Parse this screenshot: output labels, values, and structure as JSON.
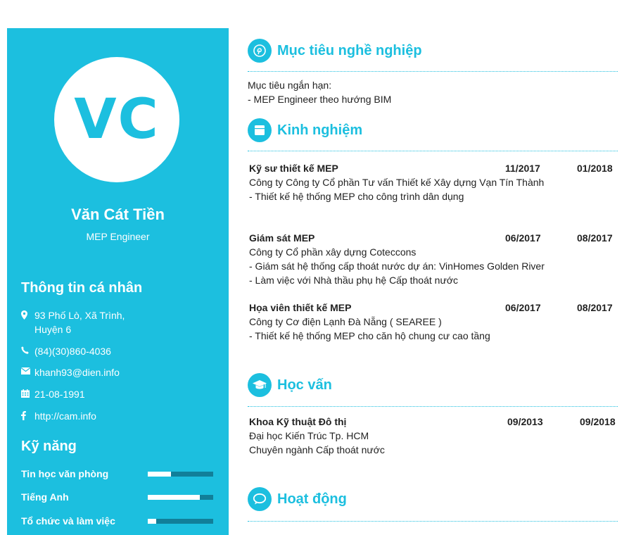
{
  "profile": {
    "initials": "VC",
    "name": "Văn Cát Tiền",
    "title": "MEP Engineer"
  },
  "personal": {
    "heading": "Thông tin cá nhân",
    "address_line1": "93 Phố Lò, Xã Trình,",
    "address_line2": "Huyện 6",
    "phone": "(84)(30)860-4036",
    "email": "khanh93@dien.info",
    "birthday": "21-08-1991",
    "website": "http://cam.info"
  },
  "skills": {
    "heading": "Kỹ năng",
    "items": [
      {
        "label": "Tin học văn phòng",
        "level": 0.35
      },
      {
        "label": "Tiếng Anh",
        "level": 0.8
      },
      {
        "label": "Tổ chức và làm việc",
        "level": 0.13
      }
    ]
  },
  "objective": {
    "heading": "Mục tiêu nghề nghiệp",
    "line1": "Mục tiêu ngắn hạn:",
    "line2": "- MEP Engineer theo hướng BIM"
  },
  "experience": {
    "heading": "Kinh nghiệm",
    "items": [
      {
        "role": "Kỹ sư thiết kế MEP",
        "start": "11/2017",
        "end": "01/2018",
        "company": "Công ty Công ty Cổ phần Tư vấn Thiết kế Xây dựng Vạn Tín Thành",
        "detail1": "- Thiết kế hệ thống MEP cho công trình dân dụng",
        "detail2": ""
      },
      {
        "role": "Giám sát MEP",
        "start": "06/2017",
        "end": "08/2017",
        "company": "Công ty Cổ phần xây dựng Coteccons",
        "detail1": "- Giám sát hệ thống cấp thoát nước dự án: VinHomes Golden River",
        "detail2": "- Làm việc với Nhà thầu phụ hệ Cấp thoát nước"
      },
      {
        "role": "Họa viên thiết kế MEP",
        "start": "06/2017",
        "end": "08/2017",
        "company": "Công ty Cơ điện Lạnh Đà Nẵng ( SEAREE )",
        "detail1": "- Thiết kế hệ thống MEP cho căn hộ chung cư cao tầng",
        "detail2": ""
      }
    ]
  },
  "education": {
    "heading": "Học vấn",
    "major": "Khoa Kỹ thuật Đô thị",
    "start": "09/2013",
    "end": "09/2018",
    "school": "Đại học Kiến Trúc Tp. HCM",
    "field": "Chuyên ngành Cấp thoát nước"
  },
  "activities": {
    "heading": "Hoạt động"
  },
  "colors": {
    "accent": "#1cbfdf",
    "bar_track": "#117f99"
  }
}
